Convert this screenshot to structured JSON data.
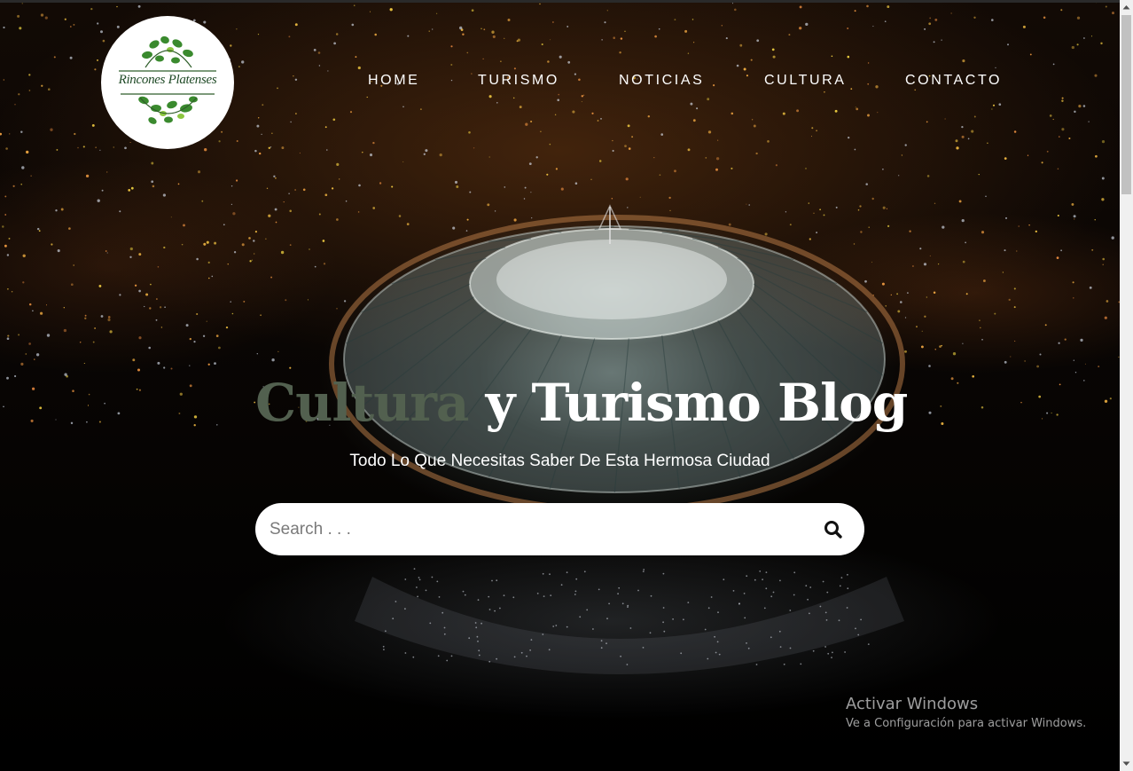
{
  "logo": {
    "text": "Rincones Platenses"
  },
  "nav": {
    "items": [
      {
        "label": "HOME"
      },
      {
        "label": "TURISMO"
      },
      {
        "label": "NOTICIAS"
      },
      {
        "label": "CULTURA"
      },
      {
        "label": "CONTACTO"
      }
    ]
  },
  "hero": {
    "title_accent": "Cultura",
    "title_rest": " y Turismo Blog",
    "subtitle": "Todo Lo Que Necesitas Saber De Esta Hermosa Ciudad"
  },
  "search": {
    "placeholder": "Search . . .",
    "value": "",
    "icon": "search-icon"
  },
  "watermark": {
    "title": "Activar Windows",
    "subtitle": "Ve a Configuración para activar Windows."
  },
  "colors": {
    "title_accent": "#52604f",
    "logo_green": "#2f6b2f",
    "background": "#000000"
  }
}
